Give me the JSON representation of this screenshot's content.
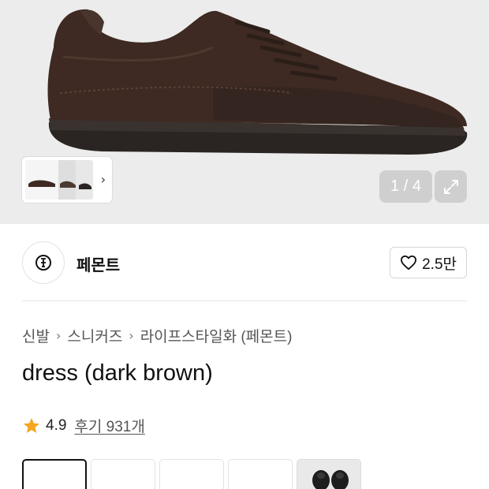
{
  "gallery": {
    "counter": "1 / 4",
    "thumbnail_nav": "next-thumbnails"
  },
  "brand": {
    "name": "페몬트",
    "like_count": "2.5만"
  },
  "breadcrumb": {
    "items": [
      "신발",
      "스니커즈",
      "라이프스타일화 (페몬트)"
    ]
  },
  "product": {
    "title": "dress (dark brown)"
  },
  "rating": {
    "score": "4.9",
    "reviews_label": "후기 931개"
  },
  "colors": {
    "star": "#f5a623",
    "shoe_suede": "#3e2a22",
    "sole": "#2a2522"
  }
}
